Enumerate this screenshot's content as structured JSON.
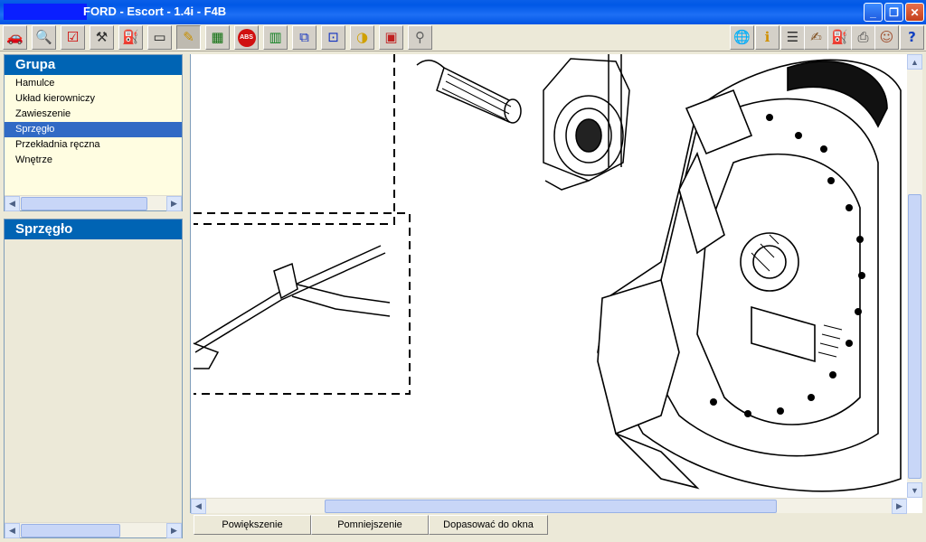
{
  "window": {
    "title": "FORD - Escort - 1.4i - F4B",
    "minimize_glyph": "_",
    "maximize_glyph": "❐",
    "close_glyph": "✕"
  },
  "toolbar": {
    "left_icons": [
      "car-icon",
      "info-search-icon",
      "checklist-icon",
      "tools-icon",
      "oil-can-icon",
      "gauge-icon",
      "pencil-icon",
      "circuit-board-icon",
      "abs-icon",
      "fuse-icon",
      "wiring-icon",
      "measure-icon",
      "timing-icon",
      "engine-icon",
      "pin-icon"
    ],
    "abs_label": "ABS",
    "right_icons": [
      "globe-icon",
      "info-icon",
      "notes-icon",
      "edit-document-icon",
      "gas-station-icon",
      "printer-icon",
      "user-icon",
      "help-icon"
    ]
  },
  "groups_panel": {
    "title": "Grupa",
    "items": [
      "Hamulce",
      "Układ kierowniczy",
      "Zawieszenie",
      "Sprzęgło",
      "Przekładnia ręczna",
      "Wnętrze"
    ],
    "selected": "Sprzęgło"
  },
  "section_panel": {
    "title": "Sprzęgło"
  },
  "drawing": {
    "description_icon": "clutch-assembly-drawing"
  },
  "bottom_buttons": {
    "zoom_in": "Powiększenie",
    "zoom_out": "Pomniejszenie",
    "fit": "Dopasować do okna"
  }
}
